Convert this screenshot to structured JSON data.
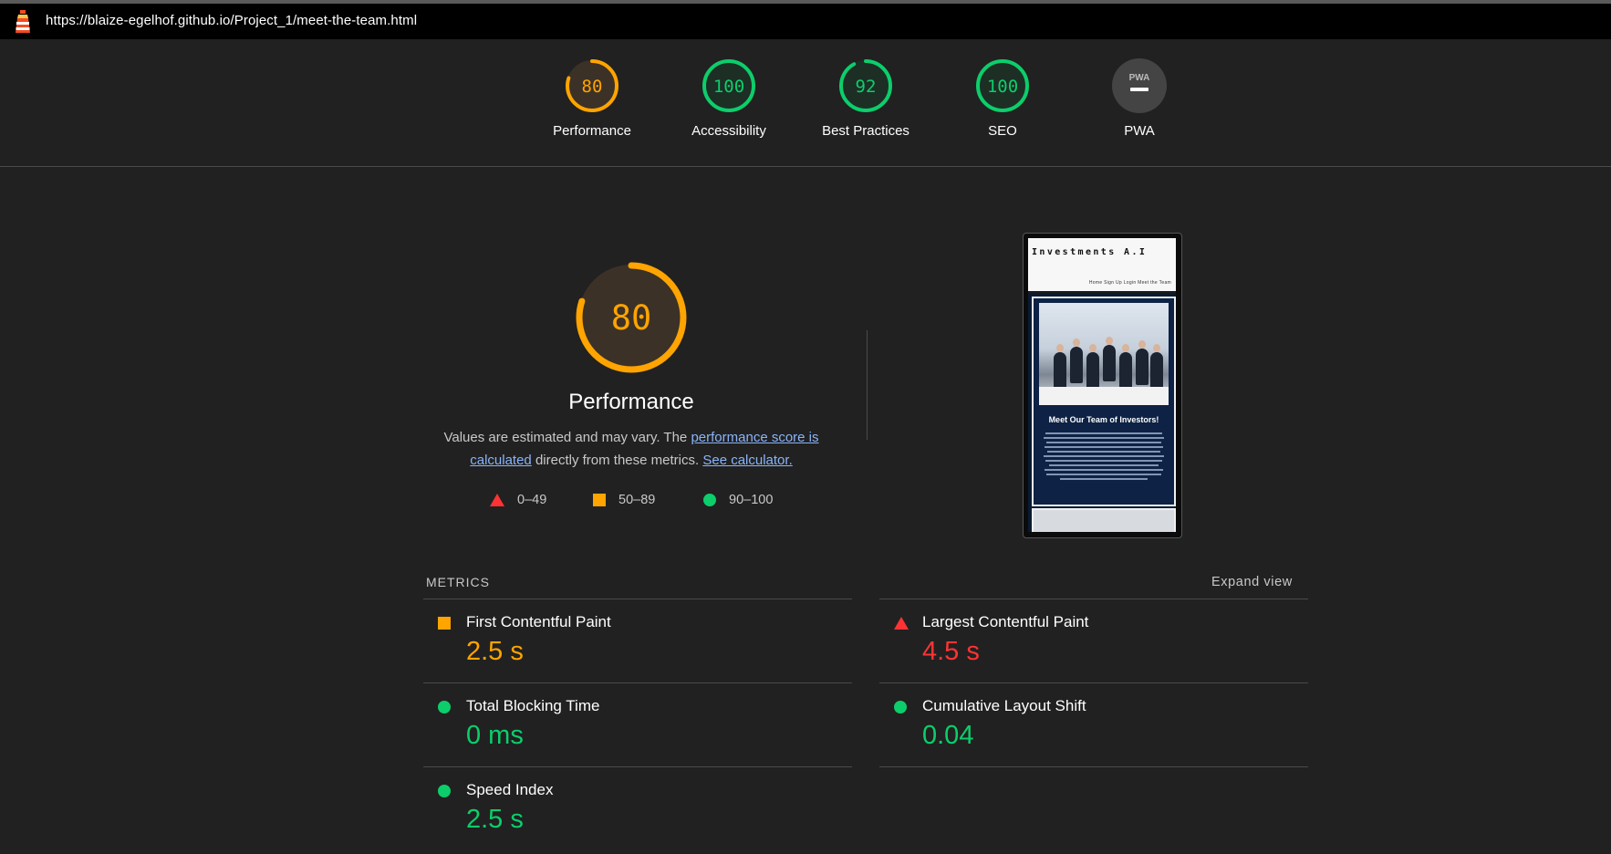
{
  "url": "https://blaize-egelhof.github.io/Project_1/meet-the-team.html",
  "colors": {
    "pass": "#0cce6b",
    "average": "#ffa400",
    "fail": "#ff3333",
    "na": "#444444"
  },
  "categories": [
    {
      "name": "Performance",
      "score": "80",
      "value": 0.8,
      "color": "#ffa400"
    },
    {
      "name": "Accessibility",
      "score": "100",
      "value": 1.0,
      "color": "#0cce6b"
    },
    {
      "name": "Best Practices",
      "score": "92",
      "value": 0.92,
      "color": "#0cce6b"
    },
    {
      "name": "SEO",
      "score": "100",
      "value": 1.0,
      "color": "#0cce6b"
    },
    {
      "name": "PWA",
      "badge": "PWA",
      "color": "#444444"
    }
  ],
  "performance": {
    "score": "80",
    "value": 0.8,
    "title": "Performance",
    "desc_prefix": "Values are estimated and may vary. The",
    "link1_line1": "performance score is",
    "link1_line2": "calculated",
    "desc_middle": "directly from these metrics.",
    "link2": "See calculator."
  },
  "legend": [
    {
      "icon": "red-triangle",
      "label": "0–49"
    },
    {
      "icon": "orange-square",
      "label": "50–89"
    },
    {
      "icon": "green-circle",
      "label": "90–100"
    }
  ],
  "screenshot": {
    "brand": "Investments A.I",
    "nav": "Home Sign Up Login Meet the Team",
    "heading": "Meet Our Team of Investors!"
  },
  "metrics_header": "METRICS",
  "expand_label": "Expand view",
  "metrics": [
    {
      "name": "First Contentful Paint",
      "value": "2.5 s",
      "rating": "average"
    },
    {
      "name": "Largest Contentful Paint",
      "value": "4.5 s",
      "rating": "fail"
    },
    {
      "name": "Total Blocking Time",
      "value": "0 ms",
      "rating": "pass"
    },
    {
      "name": "Cumulative Layout Shift",
      "value": "0.04",
      "rating": "pass"
    },
    {
      "name": "Speed Index",
      "value": "2.5 s",
      "rating": "pass"
    }
  ]
}
